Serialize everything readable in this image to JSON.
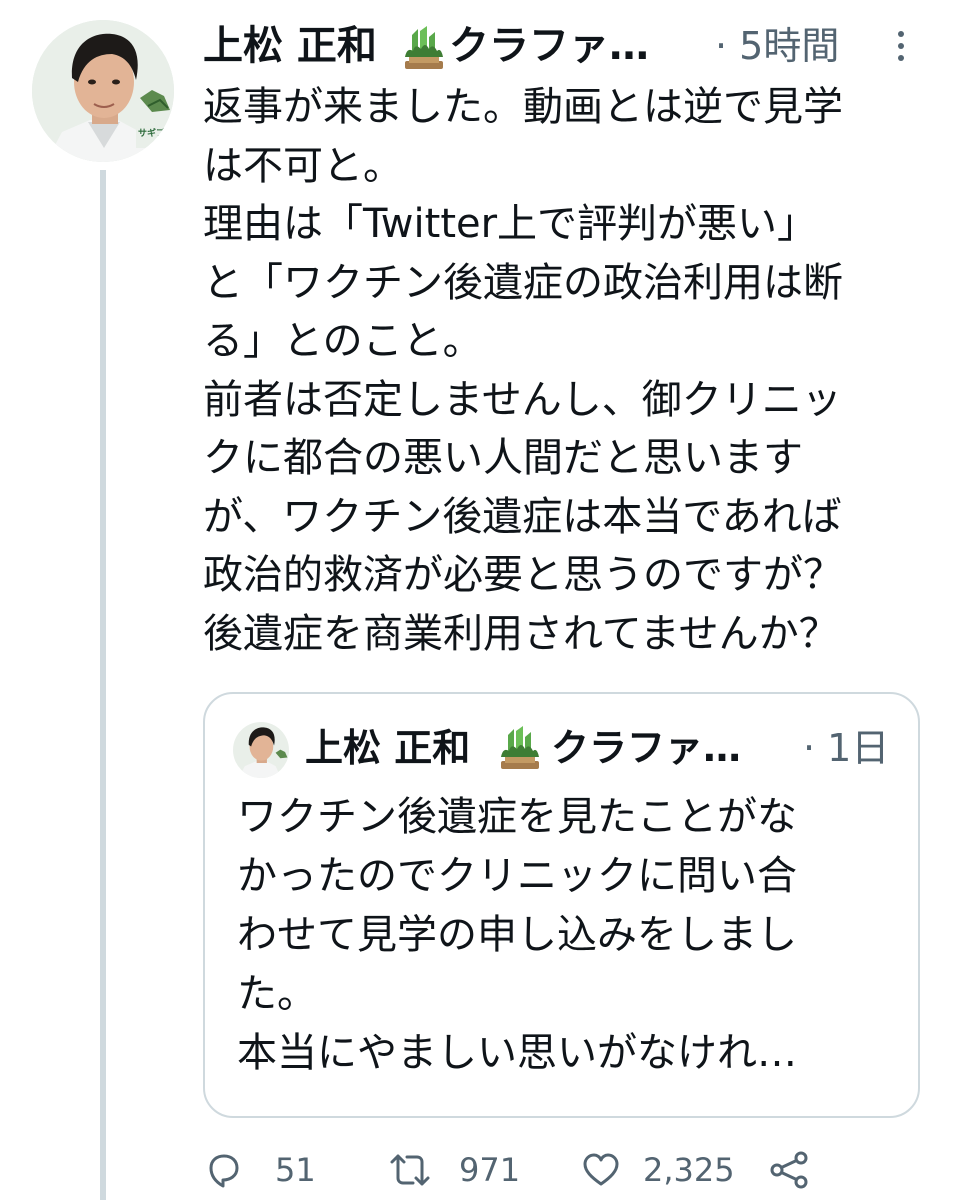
{
  "tweet": {
    "author_name": "上松 正和",
    "author_name_suffix": "クラファ…",
    "name_emoji_icon": "kadomatsu-icon",
    "time_label": "· 5時間",
    "avatar_badge_text": "サギプロ",
    "text": "返事が来ました。動画とは逆で見学\nは不可と。\n理由は「Twitter上で評判が悪い」\nと「ワクチン後遺症の政治利用は断\nる」とのこと。\n前者は否定しませんし、御クリニッ\nクに都合の悪い人間だと思います\nが、ワクチン後遺症は本当であれば\n政治的救済が必要と思うのですが？\n後遺症を商業利用されてませんか？"
  },
  "quoted_tweet": {
    "author_name": "上松 正和",
    "author_name_suffix": "クラファ…",
    "time_label": "· 1日",
    "text": "ワクチン後遺症を見たことがな\nかったのでクリニックに問い合\nわせて見学の申し込みをしまし\nた。\n本当にやましい思いがなけれ…"
  },
  "actions": {
    "reply_count": "51",
    "retweet_count": "971",
    "like_count": "2,325"
  },
  "colors": {
    "text": "#0f1419",
    "secondary": "#536471",
    "border": "#cfd9de"
  }
}
